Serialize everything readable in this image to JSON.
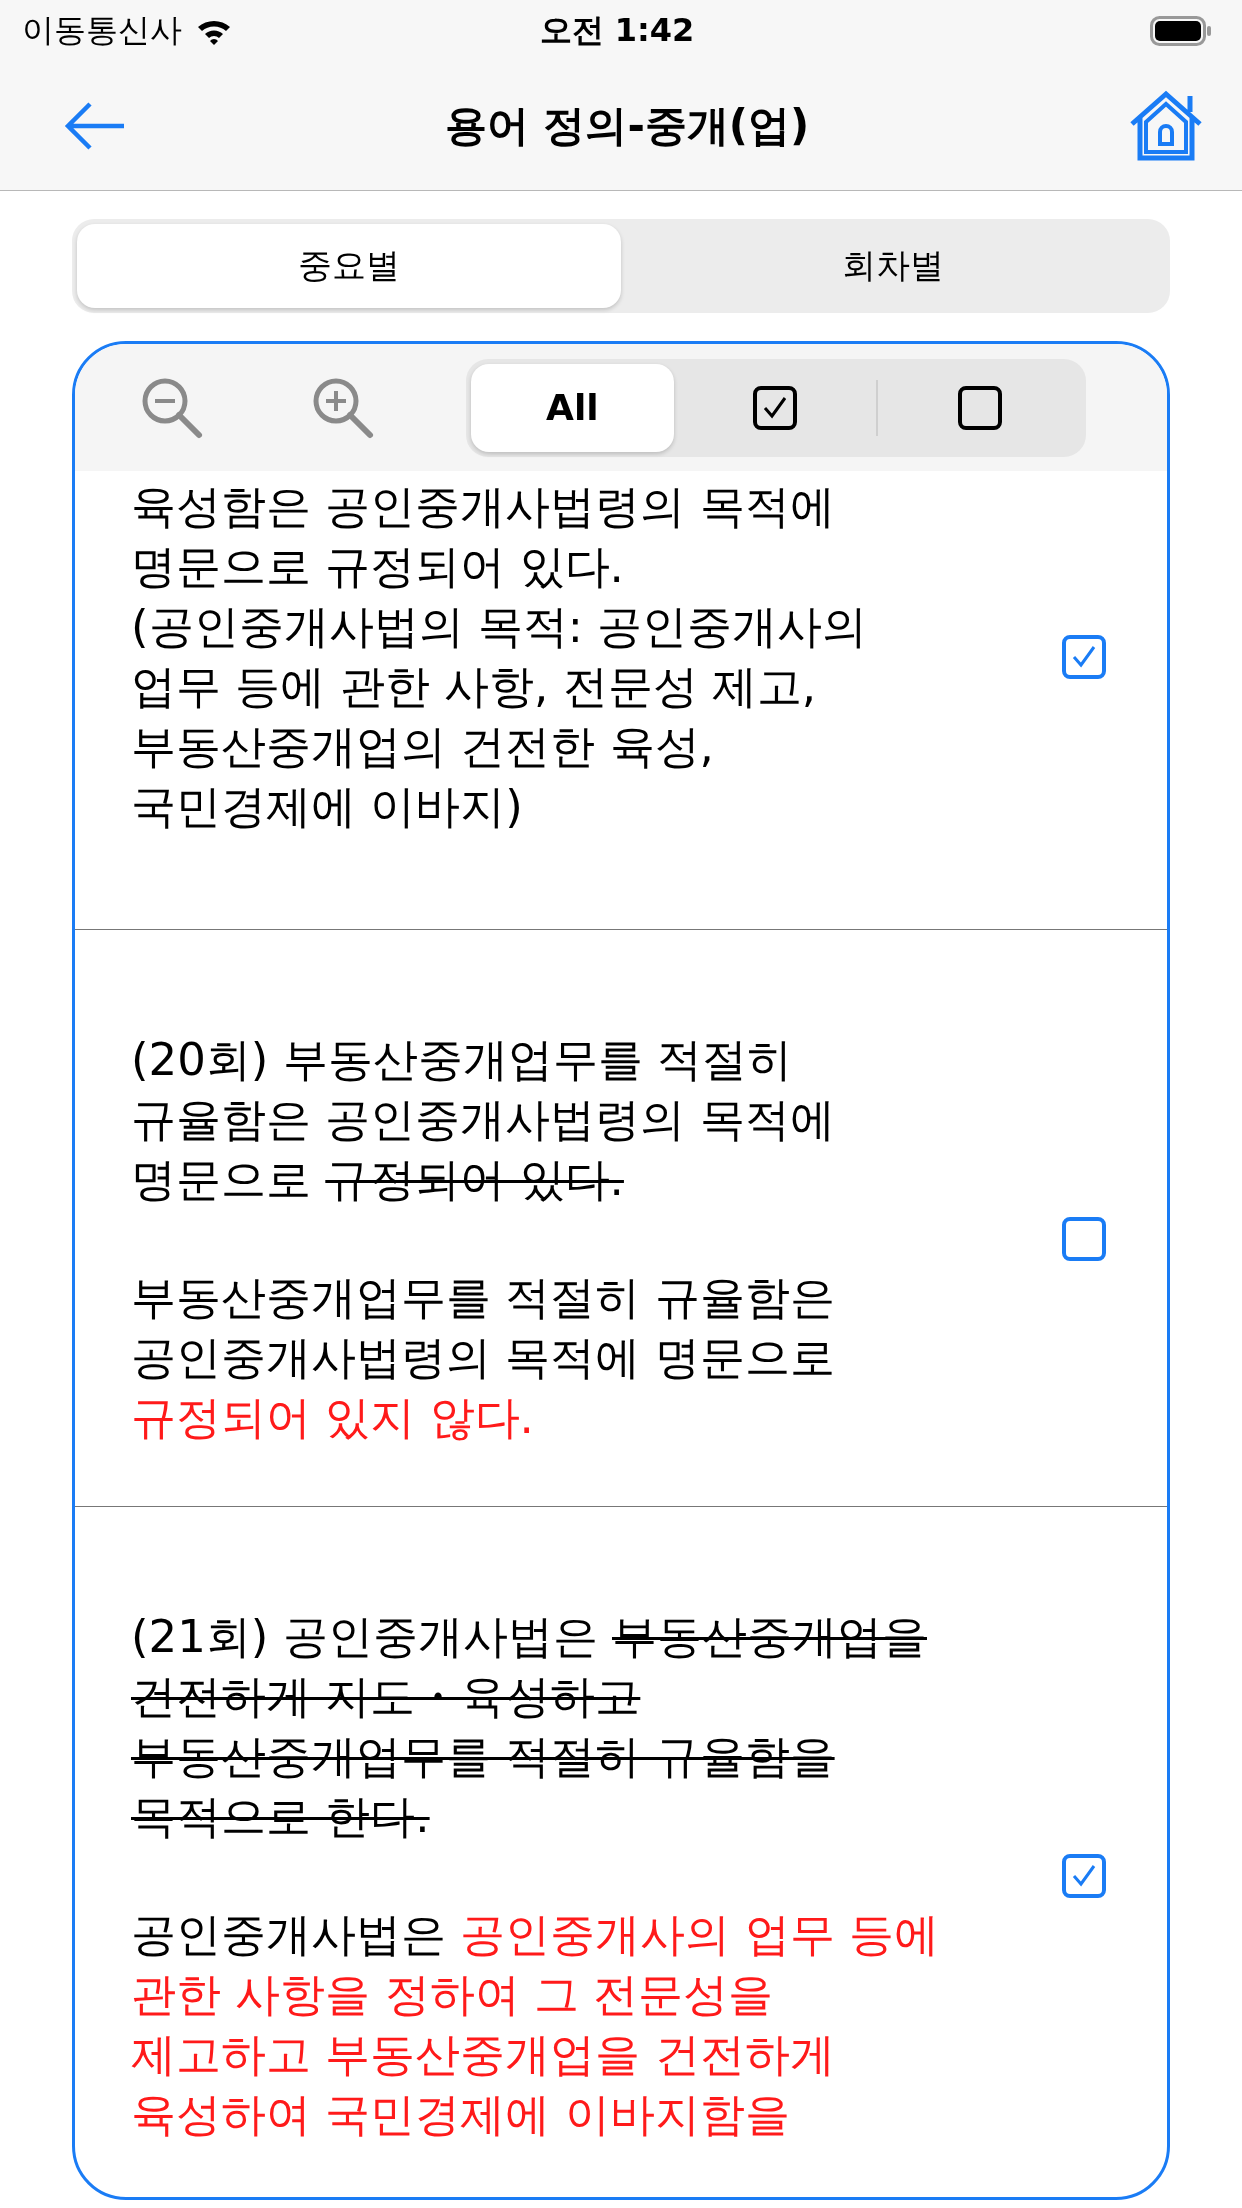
{
  "status_bar": {
    "carrier": "이동통신사",
    "time": "오전 1:42"
  },
  "nav": {
    "title": "용어 정의-중개(업)"
  },
  "tabs": [
    {
      "label": "중요별",
      "selected": true
    },
    {
      "label": "회차별",
      "selected": false
    }
  ],
  "filters": [
    {
      "kind": "text",
      "label": "All",
      "selected": true
    },
    {
      "kind": "checked",
      "selected": false
    },
    {
      "kind": "unchecked",
      "selected": false
    }
  ],
  "items": [
    {
      "checked": true,
      "paragraphs": [
        [
          [
            {
              "kind": "plain",
              "text": "육성함은 공인중개사법령의 목적에"
            }
          ],
          [
            {
              "kind": "plain",
              "text": "명문으로 규정되어 있다."
            }
          ],
          [
            {
              "kind": "plain",
              "text": "(공인중개사법의 목적: 공인중개사의"
            }
          ],
          [
            {
              "kind": "plain",
              "text": "업무 등에 관한 사항, 전문성 제고,"
            }
          ],
          [
            {
              "kind": "plain",
              "text": "부동산중개업의 건전한 육성,"
            }
          ],
          [
            {
              "kind": "plain",
              "text": "국민경제에 이바지)"
            }
          ]
        ]
      ]
    },
    {
      "checked": false,
      "paragraphs": [
        [
          [
            {
              "kind": "plain",
              "text": "(20회) 부동산중개업무를 적절히"
            }
          ],
          [
            {
              "kind": "plain",
              "text": "규율함은 공인중개사법령의 목적에"
            }
          ],
          [
            {
              "kind": "plain",
              "text": "명문으로 "
            },
            {
              "kind": "strike",
              "text": "규정되어 있다."
            }
          ]
        ],
        [
          [
            {
              "kind": "plain",
              "text": "부동산중개업무를 적절히 규율함은"
            }
          ],
          [
            {
              "kind": "plain",
              "text": "공인중개사법령의 목적에 명문으로"
            }
          ],
          [
            {
              "kind": "red",
              "text": "규정되어 있지 않다."
            }
          ]
        ]
      ]
    },
    {
      "checked": true,
      "paragraphs": [
        [
          [
            {
              "kind": "plain",
              "text": "(21회) 공인중개사법은 "
            },
            {
              "kind": "strike",
              "text": "부동산중개업을"
            }
          ],
          [
            {
              "kind": "strike",
              "text": "건전하게 지도・육성하고"
            }
          ],
          [
            {
              "kind": "strike",
              "text": "부동산중개업무를 적절히 규율함을"
            }
          ],
          [
            {
              "kind": "strike",
              "text": "목적으로 한다."
            }
          ]
        ],
        [
          [
            {
              "kind": "plain",
              "text": "공인중개사법은 "
            },
            {
              "kind": "red",
              "text": "공인중개사의 업무 등에"
            }
          ],
          [
            {
              "kind": "red",
              "text": "관한 사항을 정하여 그 전문성을"
            }
          ],
          [
            {
              "kind": "red",
              "text": "제고하고 부동산중개업을 건전하게"
            }
          ],
          [
            {
              "kind": "red",
              "text": "육성하여 국민경제에 이바지함을"
            }
          ]
        ]
      ]
    }
  ]
}
